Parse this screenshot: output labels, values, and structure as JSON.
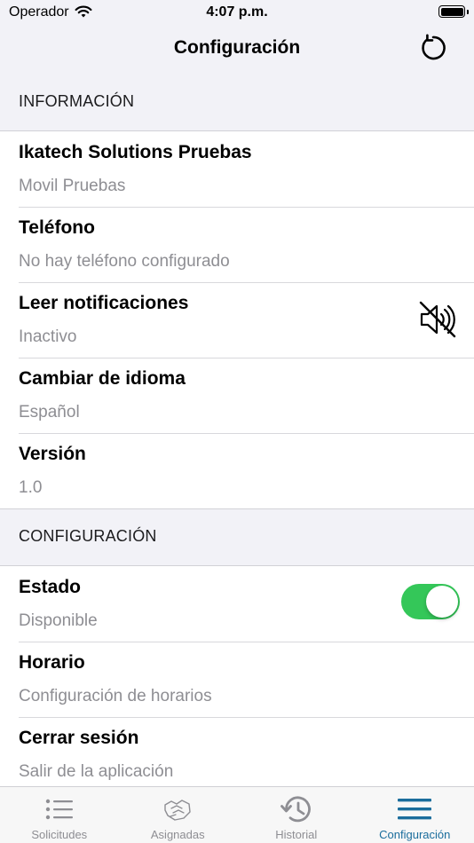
{
  "status_bar": {
    "carrier": "Operador",
    "time": "4:07 p.m."
  },
  "nav": {
    "title": "Configuración",
    "refresh_icon": "refresh-icon"
  },
  "sections": {
    "info": {
      "header": "INFORMACIÓN",
      "rows": [
        {
          "title": "Ikatech Solutions Pruebas",
          "subtitle": "Movil Pruebas"
        },
        {
          "title": "Teléfono",
          "subtitle": "No hay teléfono configurado"
        },
        {
          "title": "Leer notificaciones",
          "subtitle": "Inactivo",
          "icon": "speaker-muted-icon"
        },
        {
          "title": "Cambiar de idioma",
          "subtitle": "Español"
        },
        {
          "title": "Versión",
          "subtitle": "1.0"
        }
      ]
    },
    "config": {
      "header": "CONFIGURACIÓN",
      "rows": [
        {
          "title": "Estado",
          "subtitle": "Disponible",
          "toggle_on": true
        },
        {
          "title": "Horario",
          "subtitle": "Configuración de horarios"
        },
        {
          "title": "Cerrar sesión",
          "subtitle": "Salir de la aplicación"
        }
      ]
    }
  },
  "tabs": [
    {
      "label": "Solicitudes",
      "icon": "list-icon",
      "active": false
    },
    {
      "label": "Asignadas",
      "icon": "handshake-icon",
      "active": false
    },
    {
      "label": "Historial",
      "icon": "history-icon",
      "active": false
    },
    {
      "label": "Configuración",
      "icon": "menu-icon",
      "active": true
    }
  ],
  "colors": {
    "toggle_on": "#34c759",
    "active_tab": "#1a6d9c",
    "inactive_tab": "#8e8e93",
    "background": "#f2f2f7"
  }
}
